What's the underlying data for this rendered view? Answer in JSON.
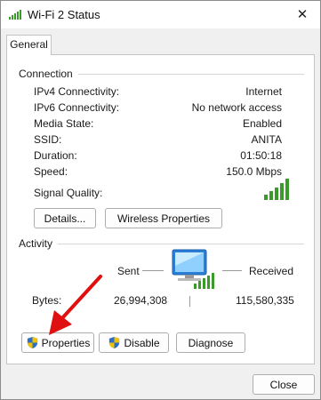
{
  "window": {
    "title": "Wi-Fi 2 Status",
    "close_glyph": "✕"
  },
  "tabs": [
    {
      "label": "General"
    }
  ],
  "connection": {
    "group_label": "Connection",
    "rows": [
      {
        "label": "IPv4 Connectivity:",
        "value": "Internet"
      },
      {
        "label": "IPv6 Connectivity:",
        "value": "No network access"
      },
      {
        "label": "Media State:",
        "value": "Enabled"
      },
      {
        "label": "SSID:",
        "value": "ANITA"
      },
      {
        "label": "Duration:",
        "value": "01:50:18"
      },
      {
        "label": "Speed:",
        "value": "150.0 Mbps"
      }
    ],
    "signal_label": "Signal Quality:",
    "signal_bars": 5,
    "details_button": "Details...",
    "wireless_properties_button": "Wireless Properties"
  },
  "activity": {
    "group_label": "Activity",
    "sent_label": "Sent",
    "received_label": "Received",
    "bytes_label": "Bytes:",
    "bytes_sent": "26,994,308",
    "bytes_received": "115,580,335"
  },
  "buttons": {
    "properties": "Properties",
    "disable": "Disable",
    "diagnose": "Diagnose",
    "close": "Close"
  },
  "colors": {
    "signal_green": "#3a9a2a",
    "arrow_red": "#e01010",
    "shield_blue": "#2a6fc9",
    "shield_yellow": "#f2c200"
  },
  "icons": {
    "title": "wifi-signal-icon",
    "network": "network-computer-icon",
    "shield": "uac-shield-icon",
    "annotation": "red-arrow"
  }
}
